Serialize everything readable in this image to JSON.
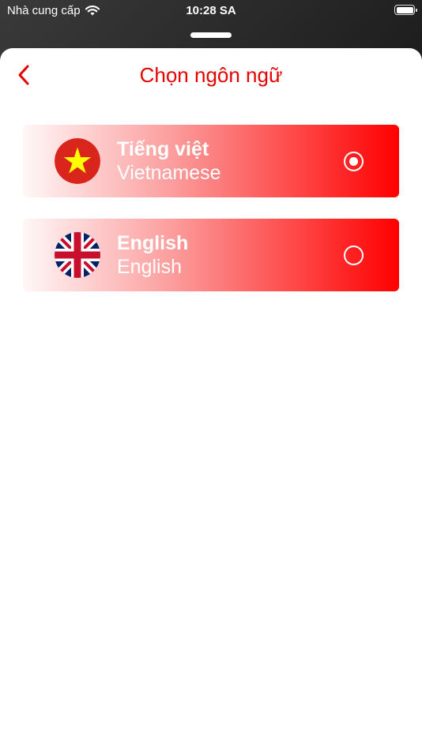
{
  "status_bar": {
    "carrier": "Nhà cung cấp",
    "time": "10:28 SA",
    "wifi_icon": "wifi-icon",
    "battery_icon": "battery-icon",
    "battery_level": 1.0
  },
  "header": {
    "title": "Chọn ngôn ngữ",
    "back_icon": "chevron-left-icon"
  },
  "languages": [
    {
      "name": "Tiếng việt",
      "subtitle": "Vietnamese",
      "flag_icon": "vietnam-flag-icon",
      "selected": true
    },
    {
      "name": "English",
      "subtitle": "English",
      "flag_icon": "uk-flag-icon",
      "selected": false
    }
  ],
  "colors": {
    "accent": "#e60000",
    "row_gradient_end": "#ff0000",
    "text_on_accent": "#ffffff"
  }
}
